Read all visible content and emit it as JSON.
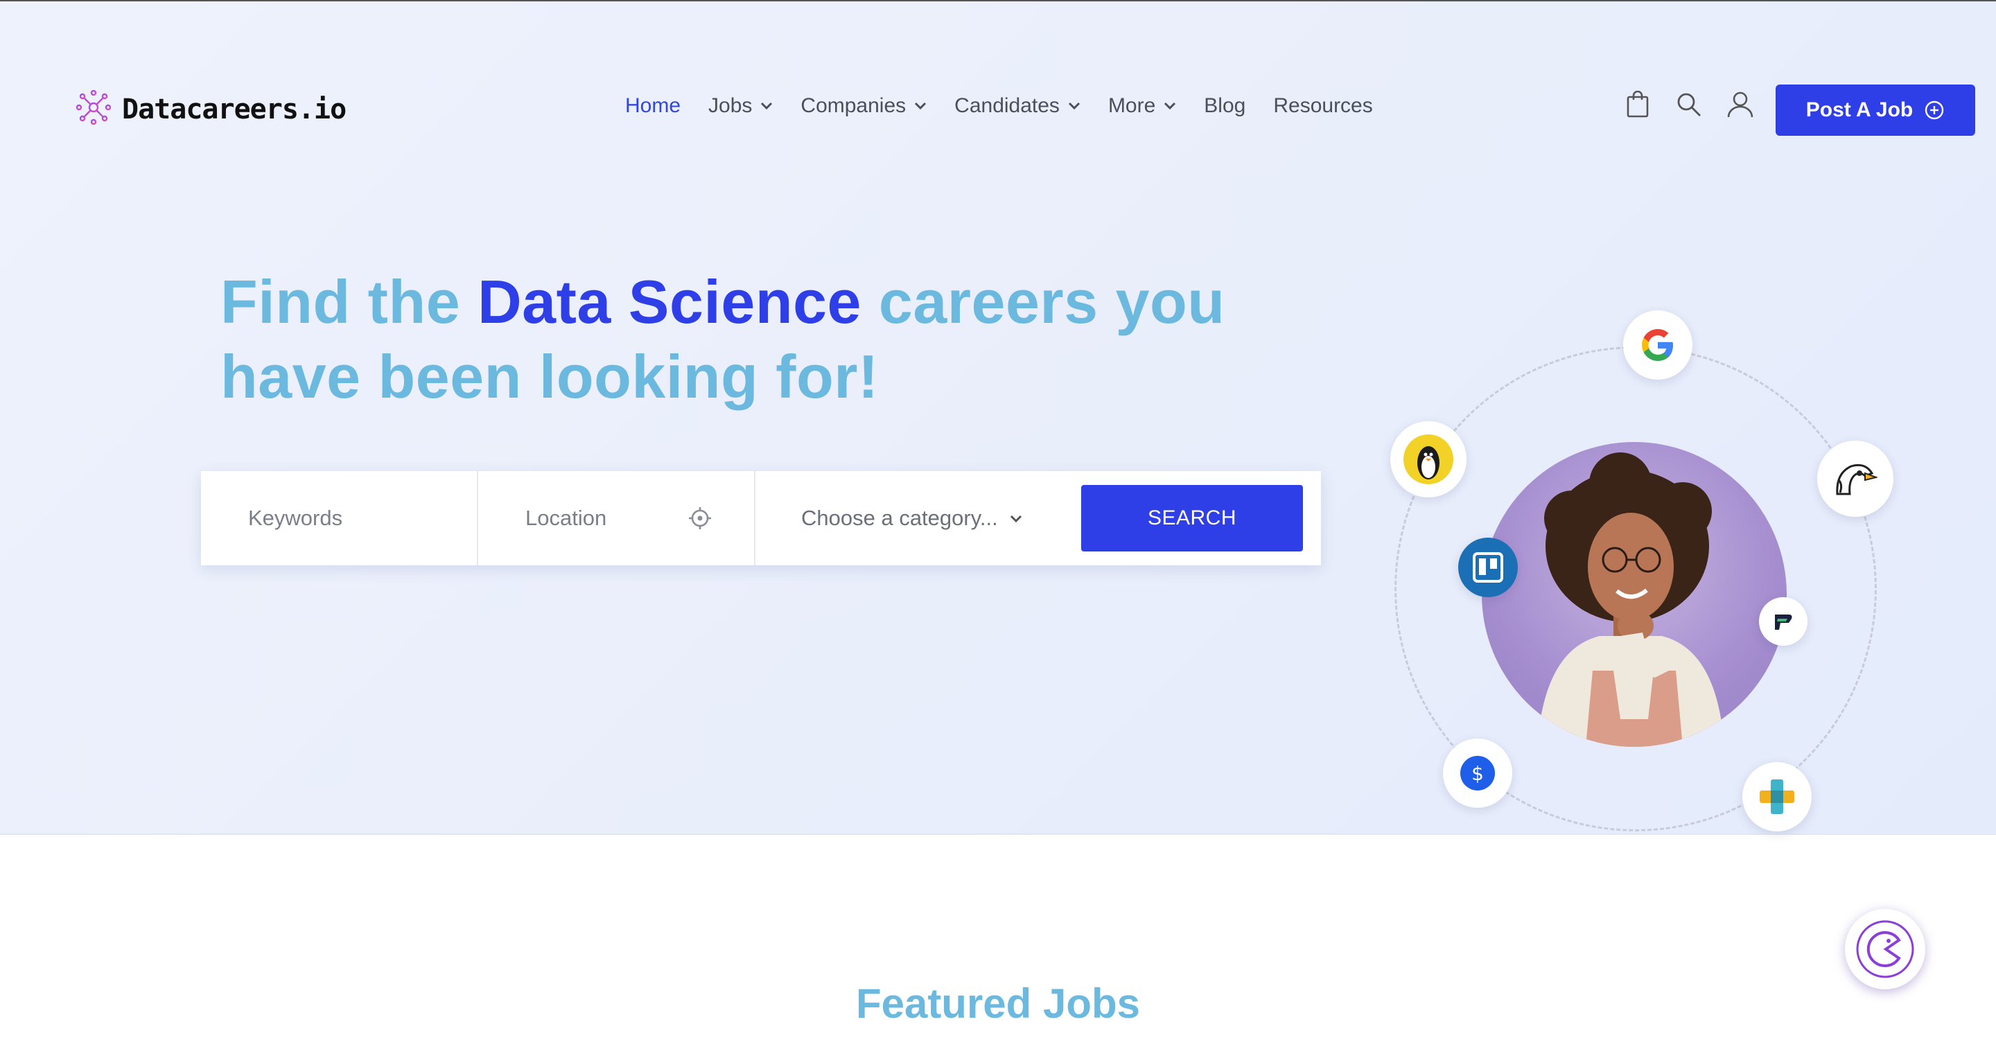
{
  "brand": {
    "name": "Datacareers.io",
    "accent": "#2f3fe7",
    "light_accent": "#6cb9e0"
  },
  "nav": {
    "items": [
      {
        "label": "Home",
        "active": true,
        "dropdown": false
      },
      {
        "label": "Jobs",
        "active": false,
        "dropdown": true
      },
      {
        "label": "Companies",
        "active": false,
        "dropdown": true
      },
      {
        "label": "Candidates",
        "active": false,
        "dropdown": true
      },
      {
        "label": "More",
        "active": false,
        "dropdown": true
      },
      {
        "label": "Blog",
        "active": false,
        "dropdown": false
      },
      {
        "label": "Resources",
        "active": false,
        "dropdown": false
      }
    ]
  },
  "header_tools": {
    "icons": [
      "shopping-bag-icon",
      "search-icon",
      "user-icon"
    ]
  },
  "post_job": {
    "label": "Post A Job",
    "icon": "plus-circle-icon"
  },
  "hero": {
    "headline_part1": "Find the ",
    "headline_highlight": "Data Science",
    "headline_part2": " careers you",
    "headline_line2": "have been looking for!"
  },
  "search": {
    "keywords_placeholder": "Keywords",
    "location_placeholder": "Location",
    "category_value": "Choose a category...",
    "button_label": "SEARCH"
  },
  "company_logos": [
    "google-logo",
    "penguin-logo",
    "bird-logo",
    "trello-logo",
    "p-logo",
    "money-logo",
    "plus-logo"
  ],
  "featured": {
    "title": "Featured Jobs"
  }
}
